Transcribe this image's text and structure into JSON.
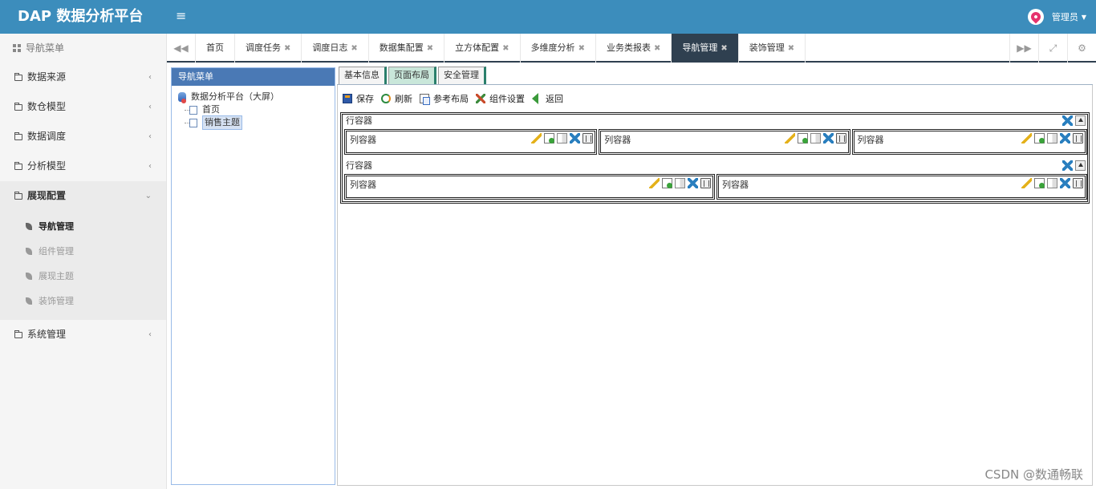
{
  "app": {
    "title": "DAP 数据分析平台",
    "menu_toggle": "≡"
  },
  "user": {
    "name": "管理员",
    "caret": "▼"
  },
  "sidebar": {
    "title": "导航菜单",
    "items": [
      {
        "label": "数据来源",
        "chev": "‹"
      },
      {
        "label": "数仓模型",
        "chev": "‹"
      },
      {
        "label": "数据调度",
        "chev": "‹"
      },
      {
        "label": "分析模型",
        "chev": "‹"
      },
      {
        "label": "展现配置",
        "chev": "⌄"
      },
      {
        "label": "系统管理",
        "chev": "‹"
      }
    ],
    "sub_items": [
      {
        "label": "导航管理"
      },
      {
        "label": "组件管理"
      },
      {
        "label": "展现主题"
      },
      {
        "label": "装饰管理"
      }
    ]
  },
  "tabbar": {
    "prev": "◀◀",
    "next": "▶▶",
    "fullscreen": "⤢",
    "settings": "⚙",
    "close_glyph": "✖",
    "tabs": [
      {
        "label": "首页"
      },
      {
        "label": "调度任务"
      },
      {
        "label": "调度日志"
      },
      {
        "label": "数据集配置"
      },
      {
        "label": "立方体配置"
      },
      {
        "label": "多维度分析"
      },
      {
        "label": "业务类报表"
      },
      {
        "label": "导航管理"
      },
      {
        "label": "装饰管理"
      }
    ]
  },
  "navpanel": {
    "title": "导航菜单",
    "root": "数据分析平台（大屏）",
    "children": [
      {
        "label": "首页"
      },
      {
        "label": "销售主题"
      }
    ]
  },
  "editor": {
    "tabs": [
      {
        "label": "基本信息"
      },
      {
        "label": "页面布局"
      },
      {
        "label": "安全管理"
      }
    ],
    "toolbar": {
      "save": "保存",
      "refresh": "刷新",
      "ref_layout": "参考布局",
      "component_settings": "组件设置",
      "back": "返回"
    },
    "row_label": "行容器",
    "col_label": "列容器"
  },
  "watermark": "CSDN @数通畅联"
}
